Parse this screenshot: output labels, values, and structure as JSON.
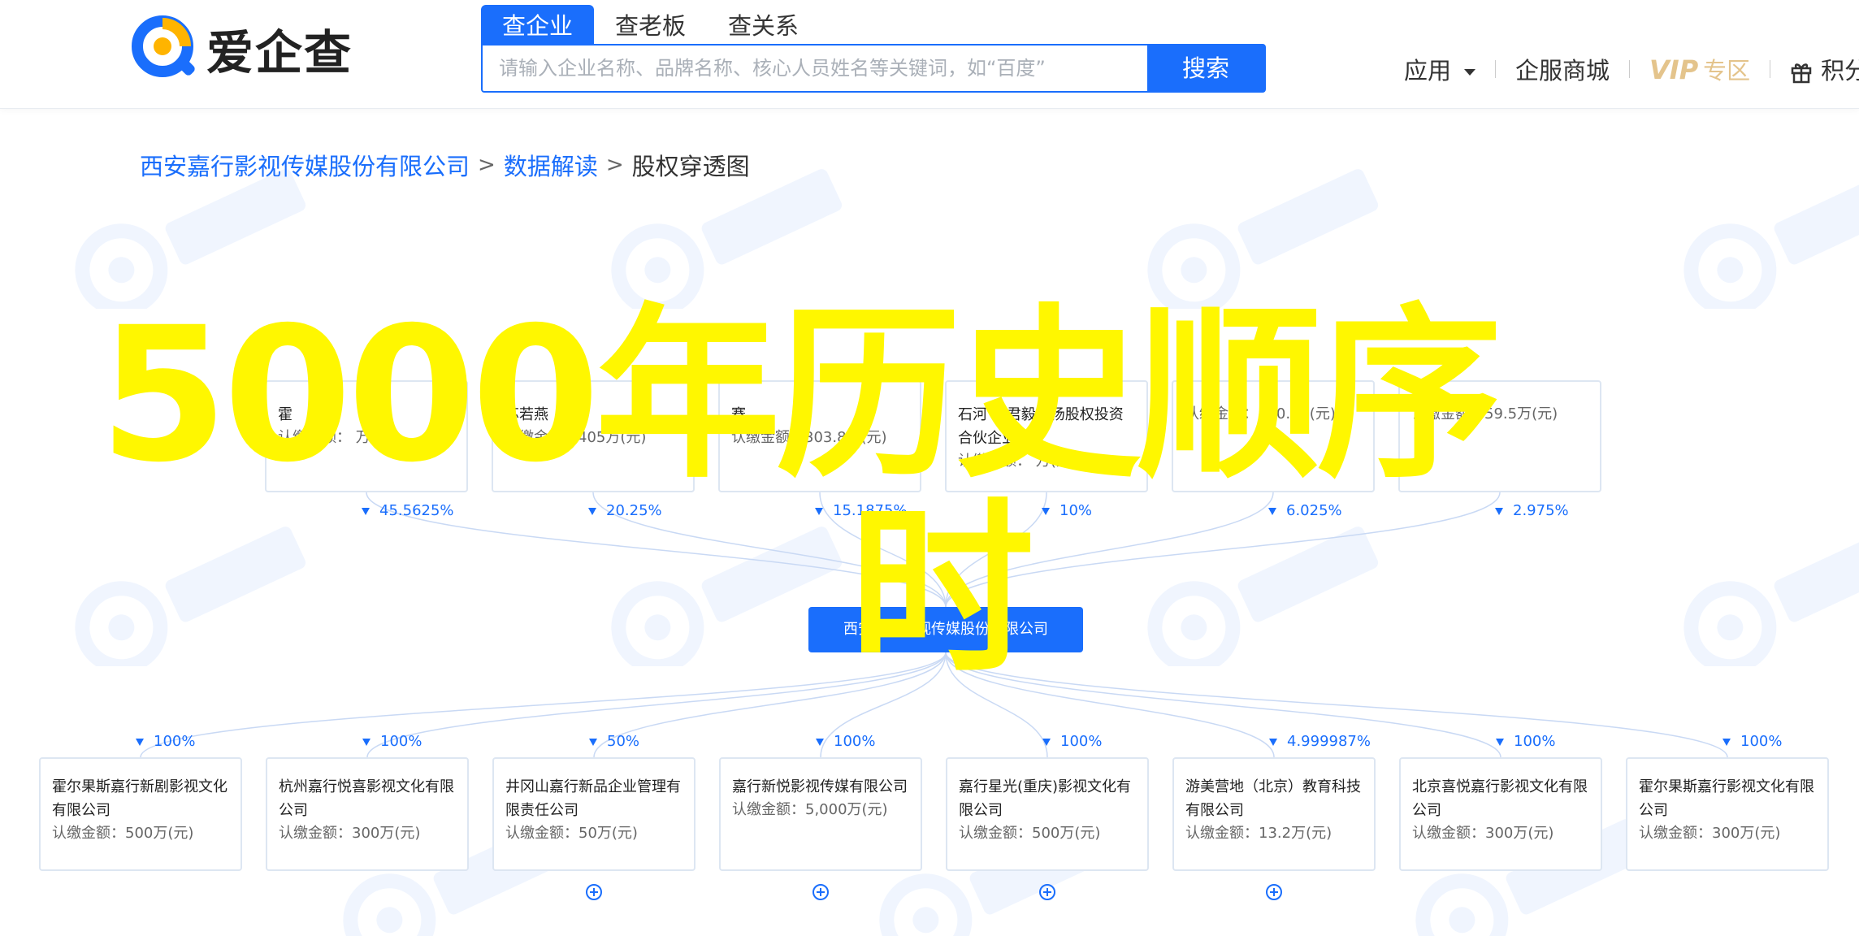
{
  "header": {
    "logo_text": "爱企查",
    "search_tabs": [
      "查企业",
      "查老板",
      "查关系"
    ],
    "search_placeholder": "请输入企业名称、品牌名称、核心人员姓名等关键词，如“百度”",
    "search_button": "搜索",
    "nav": {
      "apps": "应用",
      "mall": "企服商城",
      "vip": "VIP",
      "vip_zone": "专区",
      "points": "积分商"
    }
  },
  "breadcrumb": {
    "company": "西安嘉行影视传媒股份有限公司",
    "section": "数据解读",
    "current": "股权穿透图",
    "separator": ">"
  },
  "overlay": {
    "line1": "5000年历史顺序",
    "line2": "时"
  },
  "colors": {
    "primary": "#1a6efc",
    "overlay_text": "#fff700",
    "vip_gold": "#e4c48c",
    "border": "#dde6f2"
  },
  "shareholders": [
    {
      "name": "霍",
      "amount": "认缴金额：  万(元)",
      "percent": "45.5625%"
    },
    {
      "name": "苏若燕",
      "amount": "认缴金额：405万(元)",
      "percent": "20.25%"
    },
    {
      "name": "赛",
      "amount": "认缴金额：303.8万(元)",
      "percent": "15.1875%"
    },
    {
      "name": "石河  市君毅云扬股权投资合伙企业",
      "amount": "认缴金额：  万(元)",
      "percent": "10%"
    },
    {
      "name": "  ",
      "amount": "认缴金额：120.  万(元)",
      "percent": "6.025%"
    },
    {
      "name": "  ",
      "amount": "认缴金额：59.5万(元)",
      "percent": "2.975%"
    }
  ],
  "center_company": "西安嘉行影视传媒股份有限公司",
  "subsidiaries": [
    {
      "name": "霍尔果斯嘉行新剧影视文化有限公司",
      "amount": "认缴金额：500万(元)",
      "percent": "100%",
      "expand": false
    },
    {
      "name": "杭州嘉行悦喜影视文化有限公司",
      "amount": "认缴金额：300万(元)",
      "percent": "100%",
      "expand": false
    },
    {
      "name": "井冈山嘉行新品企业管理有限责任公司",
      "amount": "认缴金额：50万(元)",
      "percent": "50%",
      "expand": true
    },
    {
      "name": "嘉行新悦影视传媒有限公司",
      "amount": "认缴金额：5,000万(元)",
      "percent": "100%",
      "expand": true
    },
    {
      "name": "嘉行星光(重庆)影视文化有限公司",
      "amount": "认缴金额：500万(元)",
      "percent": "100%",
      "expand": true
    },
    {
      "name": "游美营地（北京）教育科技有限公司",
      "amount": "认缴金额：13.2万(元)",
      "percent": "4.999987%",
      "expand": true
    },
    {
      "name": "北京喜悦嘉行影视文化有限公司",
      "amount": "认缴金额：300万(元)",
      "percent": "100%",
      "expand": false
    },
    {
      "name": "霍尔果斯嘉行影视文化有限公司",
      "amount": "认缴金额：300万(元)",
      "percent": "100%",
      "expand": false
    }
  ]
}
